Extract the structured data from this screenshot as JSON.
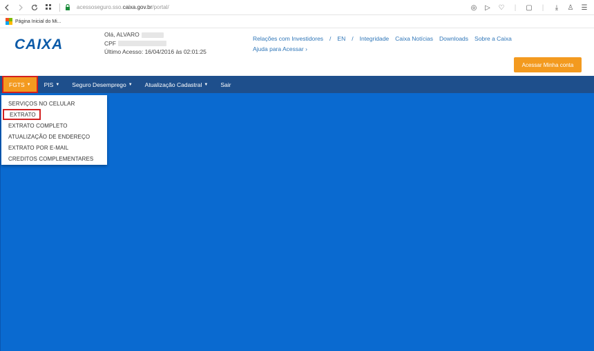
{
  "browser": {
    "back_icon": "arrow-left-icon",
    "forward_icon": "arrow-right-icon",
    "reload_icon": "reload-icon",
    "apps_icon": "apps-grid-icon",
    "url_prefix": "acessoseguro.sso.",
    "url_host": "caixa.gov.br",
    "url_path": "/portal/",
    "bookmark_label": "Página Inicial do Mi..."
  },
  "header": {
    "logo_text": "CAIXA",
    "greeting": "Olá, ALVARO",
    "cpf_label": "CPF",
    "last_access": "Último Acesso: 16/04/2016 às 02:01:25",
    "top_links": [
      "Relações com Investidores",
      "/",
      "EN",
      "/",
      "Integridade",
      "Caixa Notícias",
      "Downloads",
      "Sobre a Caixa"
    ],
    "help_link": "Ajuda para Acessar ›",
    "account_button": "Acessar Minha conta"
  },
  "nav": {
    "items": [
      {
        "label": "FGTS",
        "caret": "▼"
      },
      {
        "label": "PIS",
        "caret": "▼"
      },
      {
        "label": "Seguro Desemprego",
        "caret": "▼"
      },
      {
        "label": "Atualização Cadastral",
        "caret": "▼"
      },
      {
        "label": "Sair",
        "caret": ""
      }
    ]
  },
  "dropdown": {
    "items": [
      "SERVIÇOS NO CELULAR",
      "EXTRATO",
      "EXTRATO COMPLETO",
      "ATUALIZAÇÃO DE ENDEREÇO",
      "EXTRATO POR E-MAIL",
      "CREDITOS COMPLEMENTARES"
    ]
  },
  "colors": {
    "nav_bg": "#1e4f8c",
    "accent_orange": "#f39a1f",
    "content_blue": "#0a6ad0",
    "highlight_red": "#d21f1f",
    "link_blue": "#2f76b8"
  }
}
